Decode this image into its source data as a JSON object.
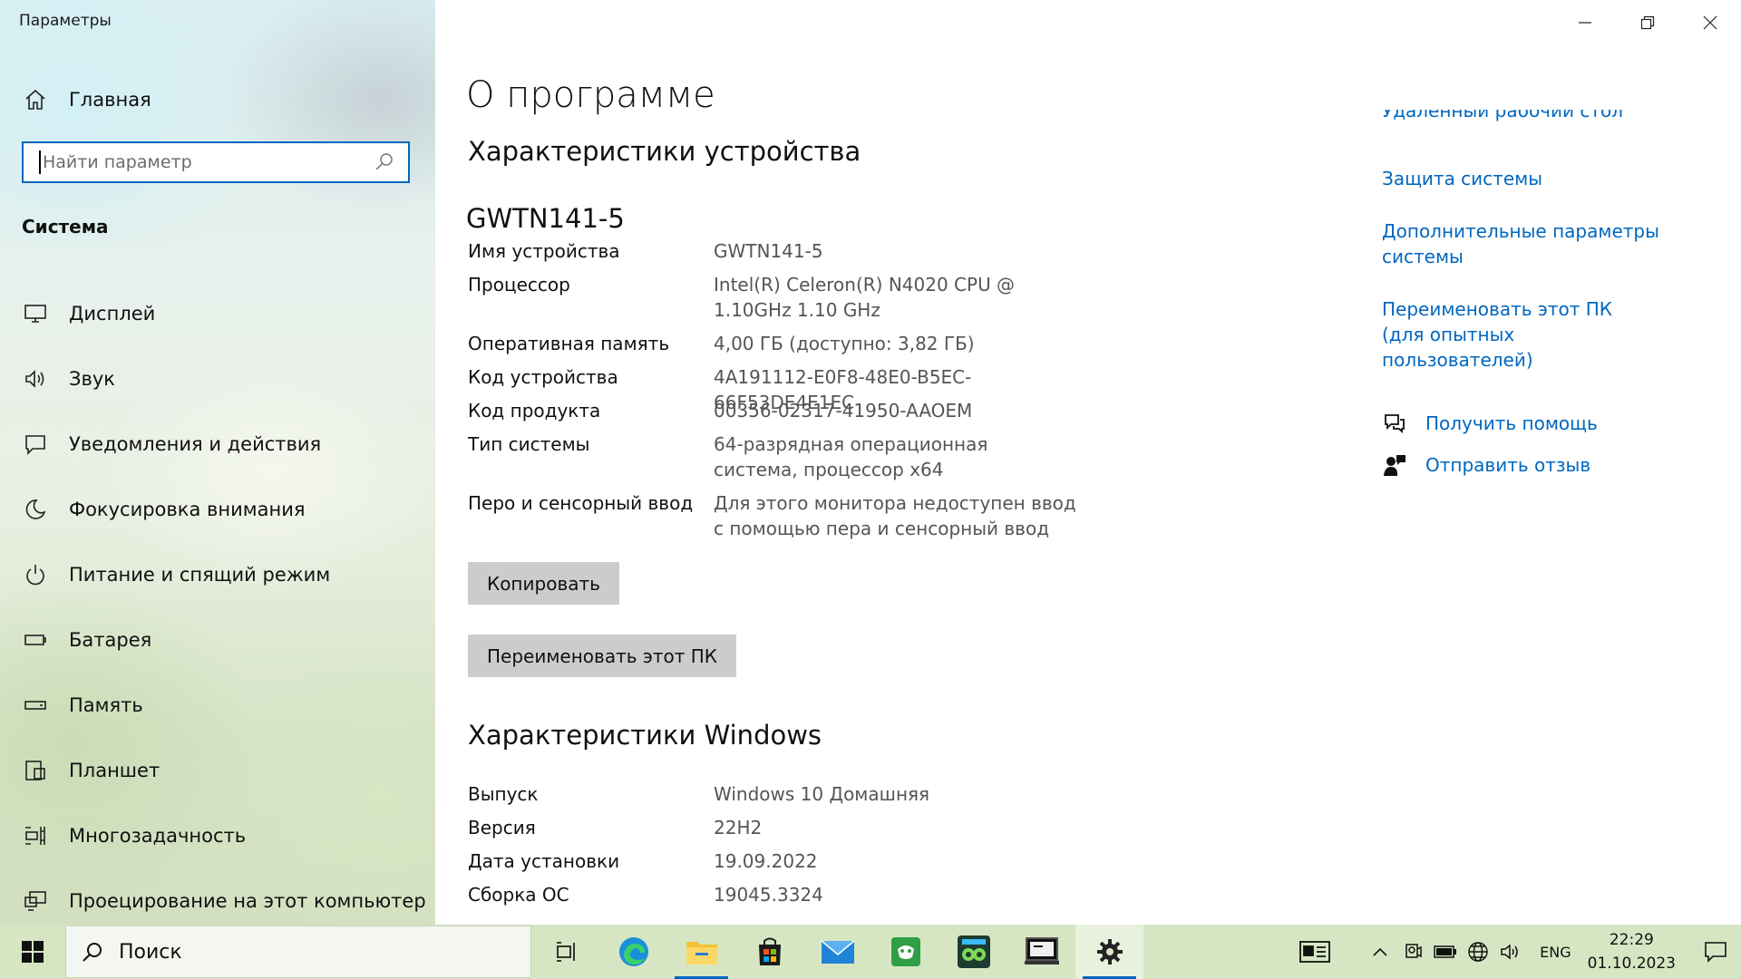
{
  "window": {
    "title": "Параметры"
  },
  "sidebar": {
    "home_label": "Главная",
    "search_placeholder": "Найти параметр",
    "section": "Система",
    "items": [
      {
        "label": "Дисплей",
        "icon": "monitor-icon"
      },
      {
        "label": "Звук",
        "icon": "speaker-icon"
      },
      {
        "label": "Уведомления и действия",
        "icon": "notification-icon"
      },
      {
        "label": "Фокусировка внимания",
        "icon": "moon-icon"
      },
      {
        "label": "Питание и спящий режим",
        "icon": "power-icon"
      },
      {
        "label": "Батарея",
        "icon": "battery-icon"
      },
      {
        "label": "Память",
        "icon": "storage-icon"
      },
      {
        "label": "Планшет",
        "icon": "tablet-icon"
      },
      {
        "label": "Многозадачность",
        "icon": "multitasking-icon"
      },
      {
        "label": "Проецирование на этот компьютер",
        "icon": "projecting-icon"
      }
    ]
  },
  "main": {
    "page_title": "О программе",
    "device_section_title": "Характеристики устройства",
    "device_name_heading": "GWTN141-5",
    "device_specs": [
      {
        "key": "Имя устройства",
        "value": "GWTN141-5"
      },
      {
        "key": "Процессор",
        "value": "Intel(R) Celeron(R) N4020 CPU @ 1.10GHz 1.10 GHz"
      },
      {
        "key": "Оперативная память",
        "value": "4,00 ГБ (доступно: 3,82 ГБ)"
      },
      {
        "key": "Код устройства",
        "value": "4A191112-E0F8-48E0-B5EC-66F53DE4E1EC"
      },
      {
        "key": "Код продукта",
        "value": "00356-02317-41950-AAOEM"
      },
      {
        "key": "Тип системы",
        "value": "64-разрядная операционная система, процессор x64"
      },
      {
        "key": "Перо и сенсорный ввод",
        "value": "Для этого монитора недоступен ввод с помощью пера и сенсорный ввод"
      }
    ],
    "copy_button": "Копировать",
    "rename_button": "Переименовать этот ПК",
    "windows_section_title": "Характеристики Windows",
    "windows_specs": [
      {
        "key": "Выпуск",
        "value": "Windows 10 Домашняя"
      },
      {
        "key": "Версия",
        "value": "22H2"
      },
      {
        "key": "Дата установки",
        "value": "19.09.2022"
      },
      {
        "key": "Сборка ОС",
        "value": "19045.3324"
      }
    ]
  },
  "related": {
    "partial_link": "Удаленный рабочий стол",
    "links": [
      "Защита системы",
      "Дополнительные параметры системы",
      "Переименовать этот ПК (для опытных пользователей)"
    ],
    "help": [
      {
        "label": "Получить помощь",
        "icon": "help-chat-icon"
      },
      {
        "label": "Отправить отзыв",
        "icon": "feedback-icon"
      }
    ]
  },
  "taskbar": {
    "search_placeholder": "Поиск",
    "apps": [
      "task-view-icon",
      "edge-icon",
      "file-explorer-icon",
      "store-icon",
      "mail-icon",
      "game-app-icon",
      "kidomi-app-icon",
      "terminal-app-icon",
      "settings-icon"
    ],
    "active_app": "settings-icon",
    "language": "ENG",
    "time": "22:29",
    "date": "01.10.2023"
  },
  "colors": {
    "accent": "#0067c0",
    "button_bg": "#cccccc",
    "taskbar_bg": "#d6e6c3"
  }
}
